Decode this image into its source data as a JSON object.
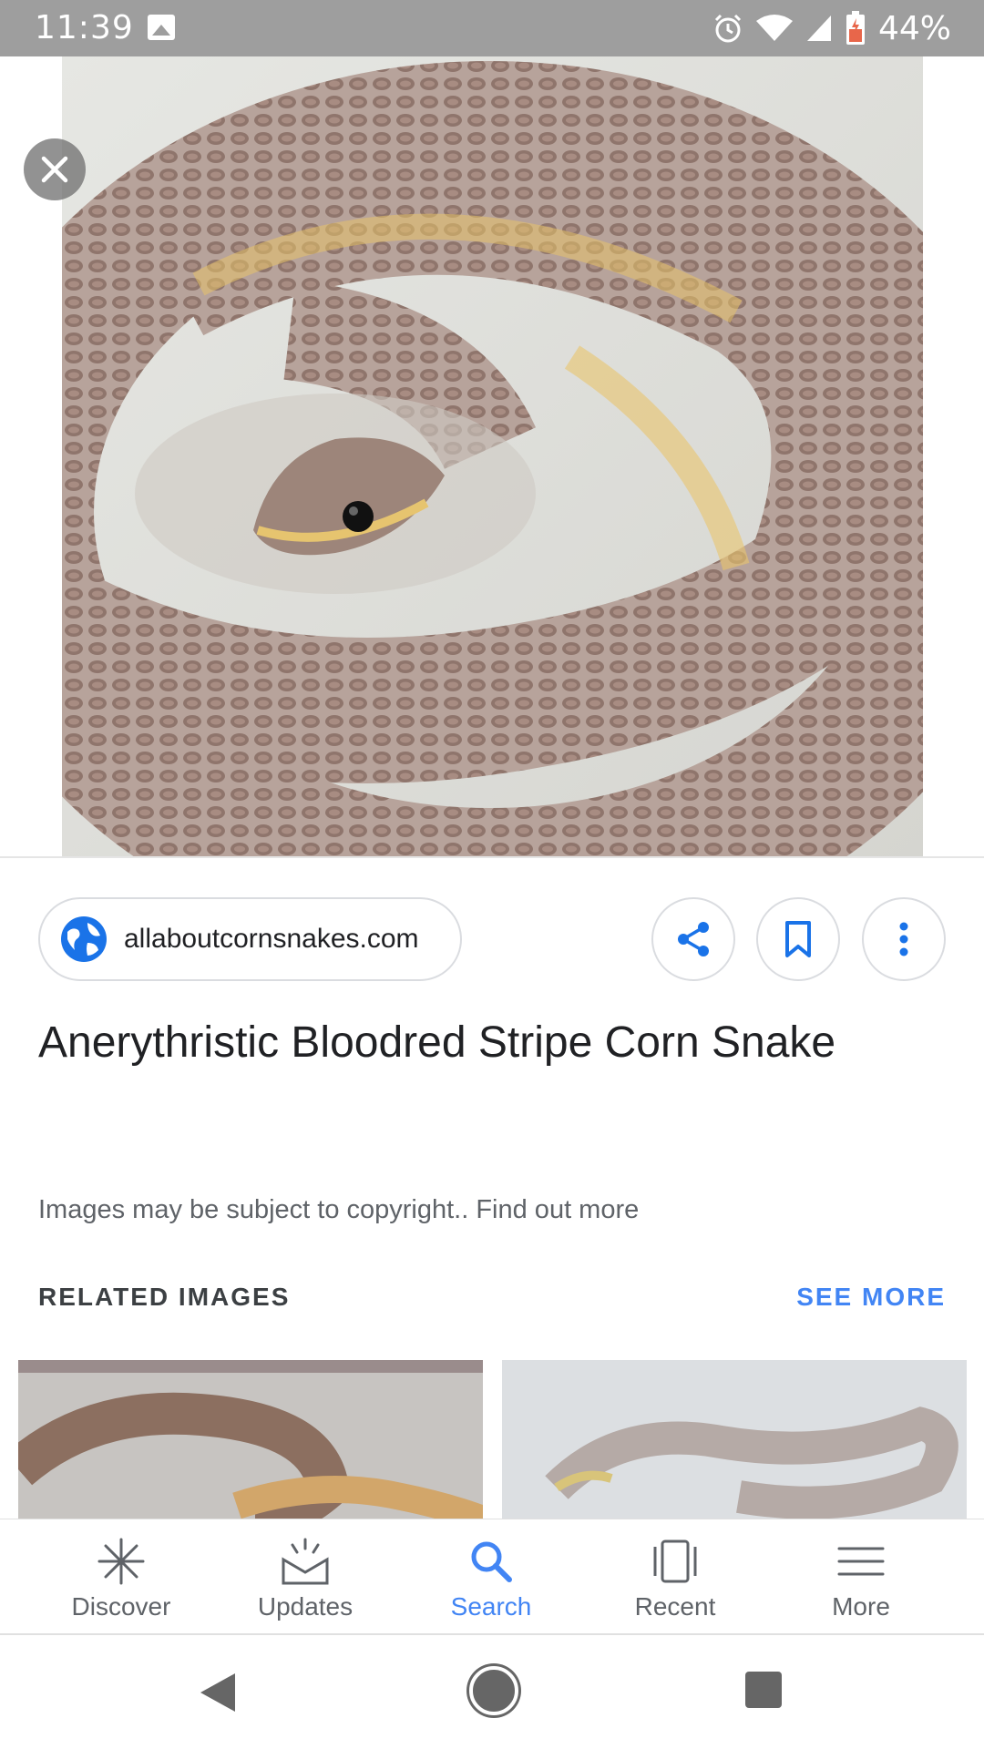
{
  "status_bar": {
    "time": "11:39",
    "battery_percent": "44%"
  },
  "source": {
    "domain": "allaboutcornsnakes.com"
  },
  "title": "Anerythristic Bloodred Stripe Corn Snake",
  "copyright_notice": "Images may be subject to copyright.. Find out more",
  "related": {
    "header": "RELATED IMAGES",
    "see_more": "SEE MORE"
  },
  "bottom_nav": {
    "items": [
      {
        "label": "Discover",
        "icon": "discover-icon"
      },
      {
        "label": "Updates",
        "icon": "updates-icon"
      },
      {
        "label": "Search",
        "icon": "search-icon"
      },
      {
        "label": "Recent",
        "icon": "recent-icon"
      },
      {
        "label": "More",
        "icon": "menu-icon"
      }
    ],
    "active": "Search"
  },
  "colors": {
    "accent": "#4285f4",
    "status_bar": "#9e9e9e",
    "text_primary": "#202124",
    "text_secondary": "#5f6368"
  }
}
